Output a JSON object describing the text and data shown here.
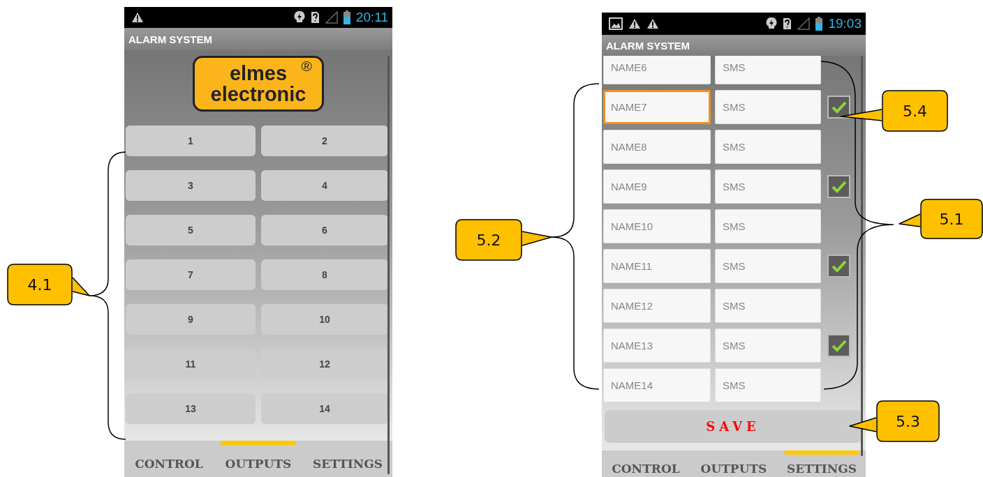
{
  "phones": [
    {
      "status_bar": {
        "time": "20:11"
      },
      "app_title": "ALARM SYSTEM",
      "kind": "outputs",
      "logo": {
        "line1": "elmes",
        "mark": "®",
        "line2": "electronic"
      },
      "output_buttons": [
        "1",
        "2",
        "3",
        "4",
        "5",
        "6",
        "7",
        "8",
        "9",
        "10",
        "11",
        "12",
        "13",
        "14"
      ],
      "tabs": [
        {
          "label": "CONTROL",
          "selected": false
        },
        {
          "label": "OUTPUTS",
          "selected": true
        },
        {
          "label": "SETTINGS",
          "selected": false
        }
      ]
    },
    {
      "status_bar": {
        "time": "19:03"
      },
      "app_title": "ALARM SYSTEM",
      "kind": "settings",
      "rows": [
        {
          "name": "NAME6",
          "sms": "SMS",
          "focused": false
        },
        {
          "name": "NAME7",
          "sms": "SMS",
          "focused": true,
          "checked": true
        },
        {
          "name": "NAME8",
          "sms": "SMS",
          "focused": false
        },
        {
          "name": "NAME9",
          "sms": "SMS",
          "focused": false,
          "checked": true
        },
        {
          "name": "NAME10",
          "sms": "SMS",
          "focused": false
        },
        {
          "name": "NAME11",
          "sms": "SMS",
          "focused": false,
          "checked": true
        },
        {
          "name": "NAME12",
          "sms": "SMS",
          "focused": false
        },
        {
          "name": "NAME13",
          "sms": "SMS",
          "focused": false,
          "checked": true
        },
        {
          "name": "NAME14",
          "sms": "SMS",
          "focused": false
        }
      ],
      "save_button": "SAVE",
      "tabs": [
        {
          "label": "CONTROL",
          "selected": false
        },
        {
          "label": "OUTPUTS",
          "selected": false
        },
        {
          "label": "SETTINGS",
          "selected": true
        }
      ]
    }
  ],
  "callouts": [
    "4.1",
    "5.2",
    "5.4",
    "5.1",
    "5.3"
  ]
}
